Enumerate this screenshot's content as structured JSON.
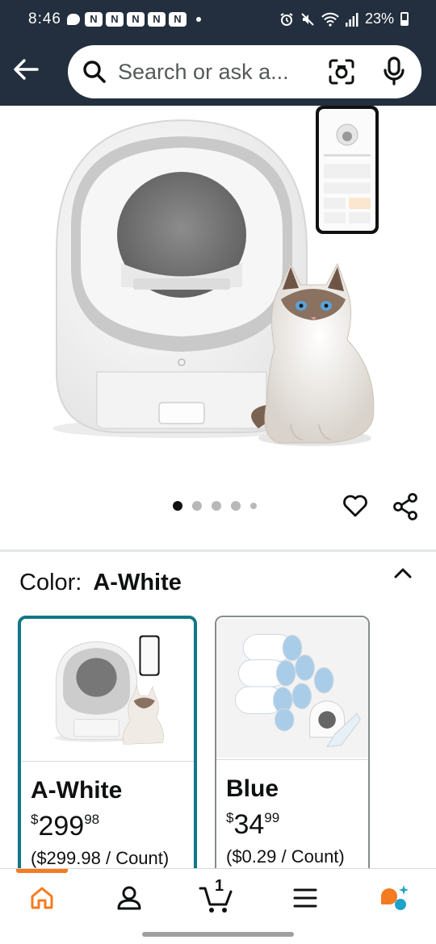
{
  "status_bar": {
    "time": "8:46",
    "notification_icons": [
      "N",
      "N",
      "N",
      "N",
      "N"
    ],
    "battery": "23%"
  },
  "header": {
    "search_placeholder": "Search or ask a..."
  },
  "gallery": {
    "image_count": 5,
    "active_index": 0
  },
  "variations": {
    "color_label": "Color:",
    "selected_color": "A-White",
    "options": [
      {
        "name": "A-White",
        "price_symbol": "$",
        "price_whole": "299",
        "price_fraction": "98",
        "unit_price": "($299.98 / Count)",
        "selected": true
      },
      {
        "name": "Blue",
        "price_symbol": "$",
        "price_whole": "34",
        "price_fraction": "99",
        "unit_price": "($0.29 / Count)",
        "selected": false
      }
    ]
  },
  "bottom_nav": {
    "cart_count": "1",
    "items": [
      "home-icon",
      "account-icon",
      "cart-icon",
      "menu-icon",
      "rufus-icon"
    ]
  },
  "colors": {
    "header_bg": "#232f3e",
    "selected_border": "#117887",
    "active_tab": "#f47b20"
  }
}
